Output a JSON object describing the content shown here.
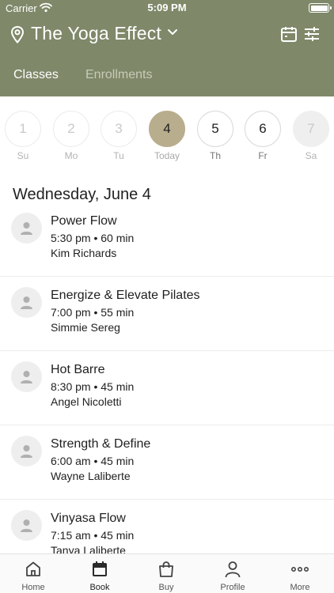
{
  "status_bar": {
    "carrier": "Carrier",
    "time": "5:09 PM"
  },
  "header": {
    "title": "The Yoga Effect"
  },
  "tabs": [
    {
      "label": "Classes",
      "active": true
    },
    {
      "label": "Enrollments",
      "active": false
    }
  ],
  "days": [
    {
      "num": "1",
      "label": "Su",
      "state": "past"
    },
    {
      "num": "2",
      "label": "Mo",
      "state": "past"
    },
    {
      "num": "3",
      "label": "Tu",
      "state": "past"
    },
    {
      "num": "4",
      "label": "Today",
      "state": "today"
    },
    {
      "num": "5",
      "label": "Th",
      "state": "future"
    },
    {
      "num": "6",
      "label": "Fr",
      "state": "future"
    },
    {
      "num": "7",
      "label": "Sa",
      "state": "off"
    }
  ],
  "date_heading": "Wednesday, June 4",
  "classes": [
    {
      "name": "Power Flow",
      "time": "5:30 pm • 60 min",
      "instructor": "Kim Richards"
    },
    {
      "name": "Energize & Elevate Pilates",
      "time": "7:00 pm • 55 min",
      "instructor": "Simmie Sereg"
    },
    {
      "name": "Hot Barre",
      "time": "8:30 pm • 45 min",
      "instructor": "Angel Nicoletti"
    },
    {
      "name": "Strength & Define",
      "time": "6:00 am • 45 min",
      "instructor": "Wayne Laliberte"
    },
    {
      "name": "Vinyasa Flow",
      "time": "7:15 am • 45 min",
      "instructor": "Tanya Laliberte"
    }
  ],
  "bottom_nav": [
    {
      "label": "Home",
      "icon": "home-icon"
    },
    {
      "label": "Book",
      "icon": "calendar-icon",
      "active": true
    },
    {
      "label": "Buy",
      "icon": "shopping-bag-icon"
    },
    {
      "label": "Profile",
      "icon": "person-icon"
    },
    {
      "label": "More",
      "icon": "more-dots-icon"
    }
  ],
  "colors": {
    "header": "#7f8869",
    "today": "#b8ad8d"
  }
}
